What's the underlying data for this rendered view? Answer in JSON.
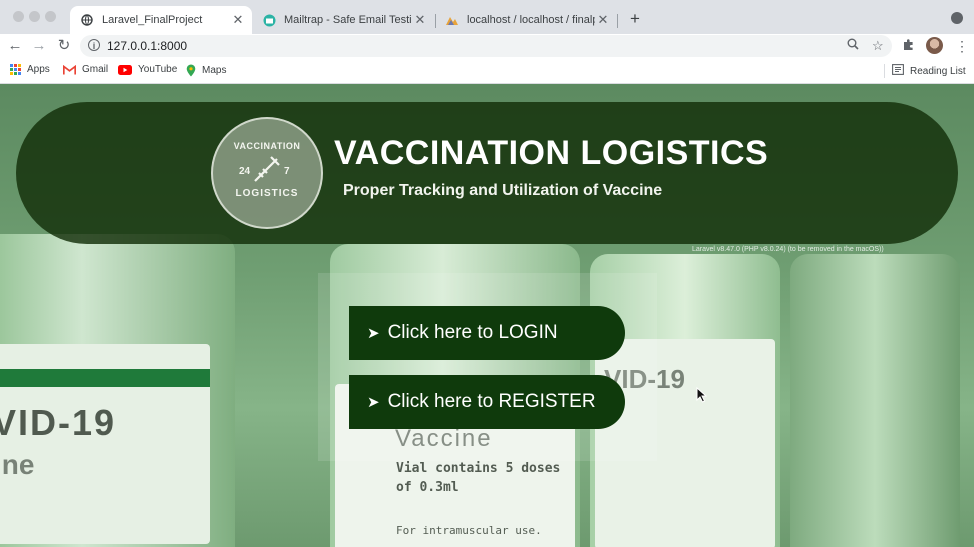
{
  "browser": {
    "tabs": [
      {
        "title": "Laravel_FinalProject",
        "icon": "globe-icon",
        "active": true
      },
      {
        "title": "Mailtrap - Safe Email Testing",
        "icon": "mailtrap-icon",
        "active": false
      },
      {
        "title": "localhost / localhost / finalproje",
        "icon": "phpmyadmin-icon",
        "active": false
      }
    ],
    "close_glyph": "✕",
    "new_tab_glyph": "+",
    "url": "127.0.0.1:8000",
    "bookmarks": [
      {
        "label": "Apps",
        "icon": "apps-grid-icon"
      },
      {
        "label": "Gmail",
        "icon": "gmail-icon"
      },
      {
        "label": "YouTube",
        "icon": "youtube-icon"
      },
      {
        "label": "Maps",
        "icon": "maps-pin-icon"
      }
    ],
    "reading_list": "Reading List"
  },
  "hero": {
    "title": "VACCINATION LOGISTICS",
    "subtitle": "Proper Tracking and Utilization of Vaccine",
    "logo": {
      "top_text": "VACCINATION",
      "left_num": "24",
      "right_num": "7",
      "bottom_text": "LOGISTICS"
    }
  },
  "version_note": "Laravel v8.47.0 (PHP v8.0.24) (to be removed in the macOS))",
  "buttons": {
    "login": "Click here to LOGIN",
    "register": "Click here to REGISTER",
    "arrow": "➤"
  },
  "background_text": {
    "left_label": "VID-19",
    "left_sub": "ine",
    "right_label": "VID-19",
    "vaccine": "Vaccine",
    "vial_line1": "Vial contains 5 doses",
    "vial_line2": "of 0.3ml",
    "vial_line3": "For intramuscular use."
  },
  "colors": {
    "hero_bg": "#122e08",
    "button_bg": "#0f3a0c",
    "page_tint": "#6f9e72"
  }
}
